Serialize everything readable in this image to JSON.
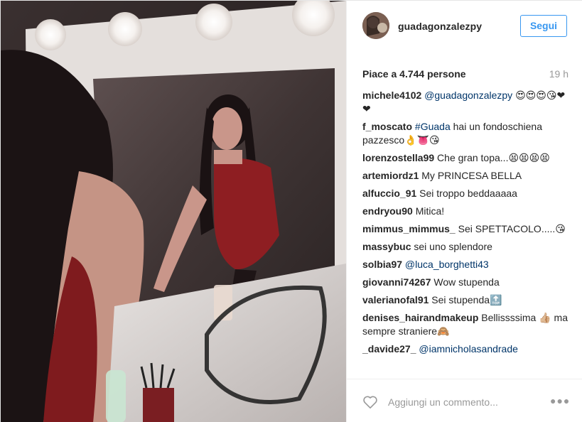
{
  "post": {
    "username": "guadagonzalezpy",
    "follow_label": "Segui",
    "likes_text": "Piace a 4.744 persone",
    "time_ago": "19 h"
  },
  "comments": [
    {
      "user": "michele4102",
      "text": "@guadagonzalezpy 😍😍😍😘❤❤"
    },
    {
      "user": "f_moscato",
      "text": "#Guada hai un fondoschiena pazzesco👌👅😘"
    },
    {
      "user": "lorenzostella99",
      "text": "Che gran topa...😫😫😫😫"
    },
    {
      "user": "artemiordz1",
      "text": "My PRINCESA BELLA"
    },
    {
      "user": "alfuccio_91",
      "text": "Sei troppo beddaaaaa"
    },
    {
      "user": "endryou90",
      "text": "Mitica!"
    },
    {
      "user": "mimmus_mimmus_",
      "text": "Sei SPETTACOLO.....😘"
    },
    {
      "user": "massybuc",
      "text": "sei uno splendore"
    },
    {
      "user": "solbia97",
      "text": "@luca_borghetti43"
    },
    {
      "user": "giovanni74267",
      "text": "Wow stupenda"
    },
    {
      "user": "valerianofal91",
      "text": "Sei stupenda🔝"
    },
    {
      "user": "denises_hairandmakeup",
      "text": "Bellissssima 👍🏼 ma sempre straniere🙈"
    },
    {
      "user": "_davide27_",
      "text": "@iamnicholasandrade"
    }
  ],
  "input": {
    "placeholder": "Aggiungi un commento..."
  },
  "icons": {
    "like": "heart-outline-icon",
    "more": "ellipsis-icon"
  },
  "colors": {
    "accent": "#3897f0",
    "link": "#003569",
    "muted": "#999999"
  }
}
